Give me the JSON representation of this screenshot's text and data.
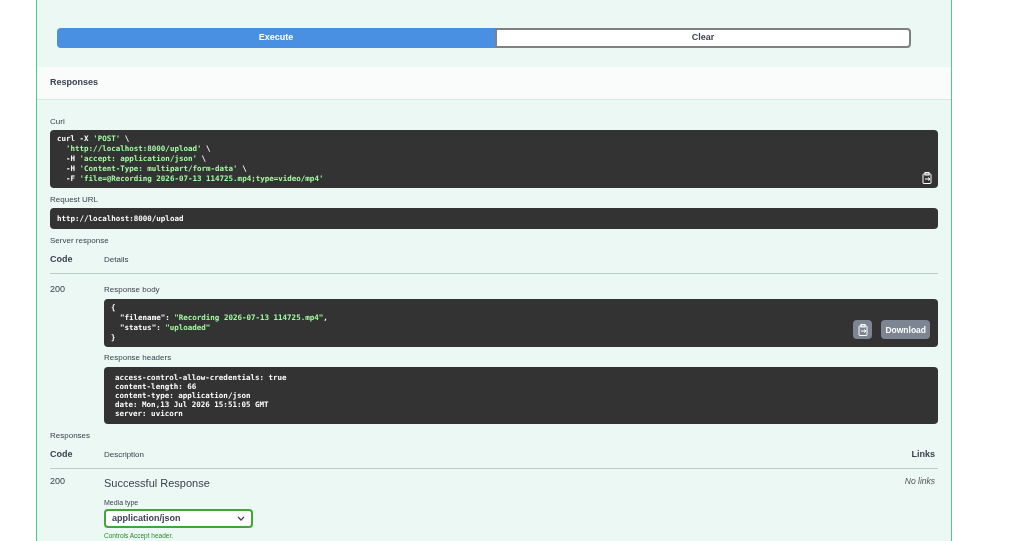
{
  "actions": [
    {
      "kind": "primary",
      "label": "Execute"
    },
    {
      "kind": "secondary",
      "label": "Clear"
    }
  ],
  "responses_header": {
    "title": "Responses"
  },
  "curl": {
    "label": "Curl",
    "lines": [
      [
        {
          "kind": "plain",
          "text": "curl -X "
        },
        {
          "kind": "string",
          "text": "'POST'"
        },
        {
          "kind": "plain",
          "text": " \\"
        }
      ],
      [
        {
          "kind": "string",
          "text": "  'http://localhost:8000/upload'"
        },
        {
          "kind": "plain",
          "text": " \\"
        }
      ],
      [
        {
          "kind": "plain",
          "text": "  -H "
        },
        {
          "kind": "string",
          "text": "'accept: application/json'"
        },
        {
          "kind": "plain",
          "text": " \\"
        }
      ],
      [
        {
          "kind": "plain",
          "text": "  -H "
        },
        {
          "kind": "string",
          "text": "'Content-Type: multipart/form-data'"
        },
        {
          "kind": "plain",
          "text": " \\"
        }
      ],
      [
        {
          "kind": "plain",
          "text": "  -F "
        },
        {
          "kind": "string",
          "text": "'file=@Recording 2026-07-13 114725.mp4;type=video/mp4'"
        }
      ]
    ]
  },
  "request_url": {
    "label": "Request URL",
    "value": "http://localhost:8000/upload"
  },
  "server_response": {
    "label": "Server response",
    "columns": [
      "Code",
      "Details"
    ],
    "code": "200",
    "body": {
      "label": "Response body",
      "lines": [
        [
          {
            "kind": "plain",
            "text": "{"
          }
        ],
        [
          {
            "kind": "plain",
            "text": "  \"filename\": "
          },
          {
            "kind": "string",
            "text": "\"Recording 2026-07-13 114725.mp4\""
          },
          {
            "kind": "plain",
            "text": ","
          }
        ],
        [
          {
            "kind": "plain",
            "text": "  \"status\": "
          },
          {
            "kind": "string",
            "text": "\"uploaded\""
          }
        ],
        [
          {
            "kind": "plain",
            "text": "}"
          }
        ]
      ],
      "download": "Download"
    },
    "headers": {
      "label": "Response headers",
      "lines": [
        "access-control-allow-credentials: true",
        "content-length: 66",
        "content-type: application/json",
        "date: Mon,13 Jul 2026 15:51:05 GMT",
        "server: uvicorn"
      ]
    }
  },
  "responses": {
    "label": "Responses",
    "columns": [
      "Code",
      "Description",
      "Links"
    ],
    "rows": [
      {
        "code": "200",
        "description": "Successful Response",
        "links": "No links",
        "media_type_label": "Media type",
        "media_type": "application/json",
        "hint": "Controls Accept header."
      }
    ]
  }
}
